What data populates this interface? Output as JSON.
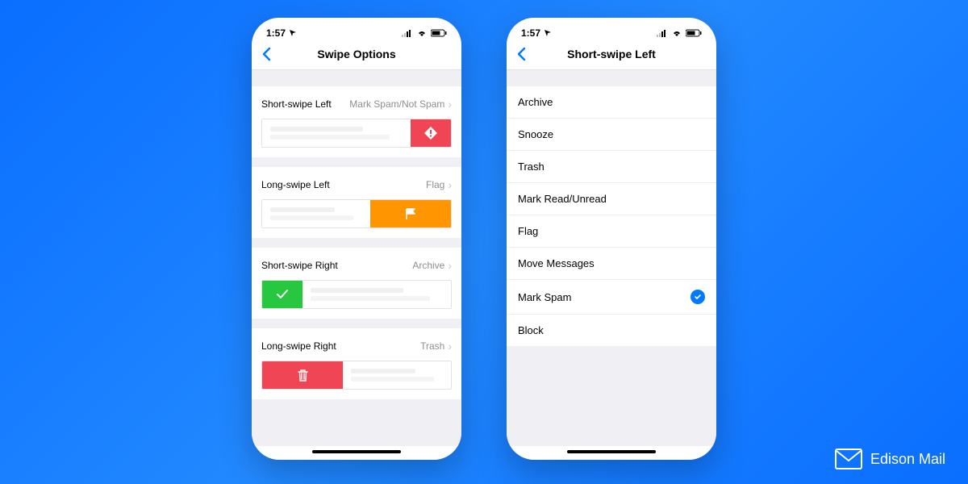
{
  "status": {
    "time": "1:57"
  },
  "phone1": {
    "title": "Swipe Options",
    "rows": {
      "shortLeft": {
        "label": "Short-swipe Left",
        "value": "Mark Spam/Not Spam"
      },
      "longLeft": {
        "label": "Long-swipe Left",
        "value": "Flag"
      },
      "shortRight": {
        "label": "Short-swipe Right",
        "value": "Archive"
      },
      "longRight": {
        "label": "Long-swipe Right",
        "value": "Trash"
      }
    }
  },
  "phone2": {
    "title": "Short-swipe Left",
    "options": {
      "archive": "Archive",
      "snooze": "Snooze",
      "trash": "Trash",
      "markRead": "Mark Read/Unread",
      "flag": "Flag",
      "move": "Move Messages",
      "markSpam": "Mark Spam",
      "block": "Block"
    },
    "selected": "markSpam"
  },
  "brand": "Edison Mail"
}
